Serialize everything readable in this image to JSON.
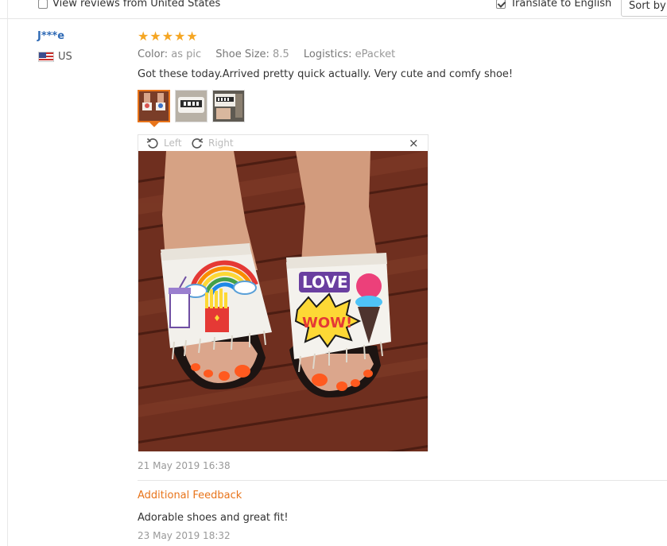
{
  "filters": {
    "reviews_country_label": "View reviews from United States",
    "reviews_country_checked": false,
    "translate_label": "Translate to English",
    "translate_checked": true,
    "sort_label": "Sort by d"
  },
  "review": {
    "user": "J***e",
    "country": "US",
    "rating": 5,
    "stars": "★★★★★",
    "attributes": [
      {
        "key": "Color:",
        "value": "as pic"
      },
      {
        "key": "Shoe Size:",
        "value": "8.5"
      },
      {
        "key": "Logistics:",
        "value": "ePacket"
      }
    ],
    "text": "Got these today.Arrived pretty quick actually. Very cute and comfy shoe!",
    "viewer": {
      "rotate_left": "Left",
      "rotate_right": "Right",
      "close": "×"
    },
    "date": "21 May 2019 16:38",
    "additional": {
      "title": "Additional Feedback",
      "text": "Adorable shoes and great fit!",
      "date": "23 May 2019 18:32"
    }
  },
  "colors": {
    "accent": "#e8741a",
    "username": "#2f6ab5",
    "star": "#f5a623",
    "muted": "#999999"
  }
}
